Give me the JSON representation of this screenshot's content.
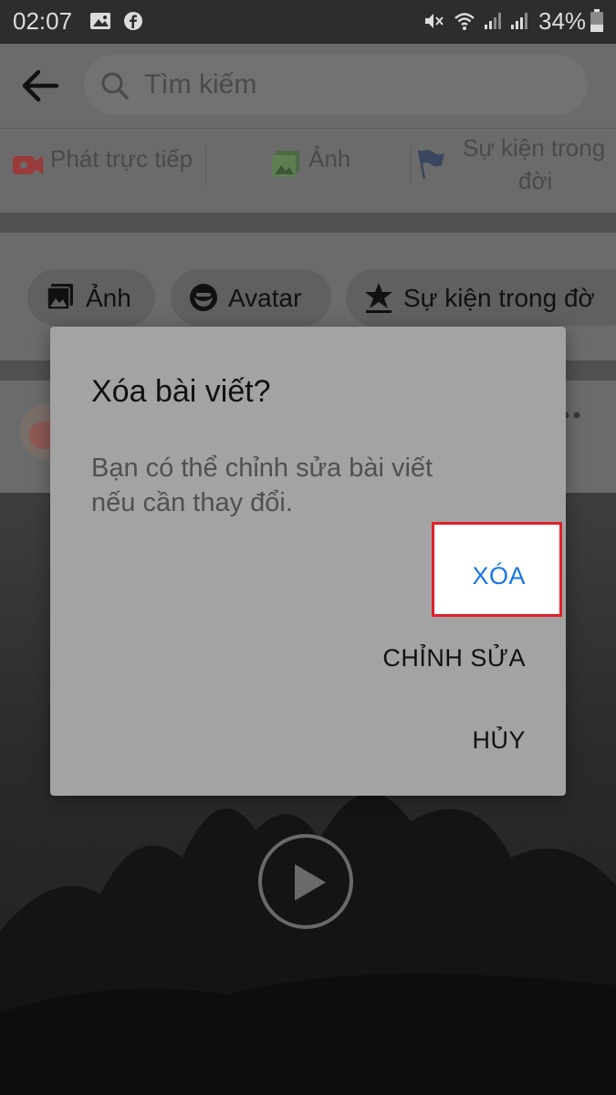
{
  "status_bar": {
    "time": "02:07",
    "battery": "34%",
    "icons": [
      "gallery-icon",
      "facebook-icon",
      "mute-icon",
      "wifi-icon",
      "signal-icon",
      "signal-icon",
      "battery-icon"
    ]
  },
  "app_bar": {
    "back_icon": "back-arrow-icon",
    "search_placeholder": "Tìm kiếm"
  },
  "composer": {
    "live_label": "Phát trực tiếp",
    "photo_label": "Ảnh",
    "life_event_label_line1": "Sự kiện trong",
    "life_event_label_line2": "đời"
  },
  "chips": {
    "photo": "Ảnh",
    "avatar": "Avatar",
    "life_event": "Sự kiện trong đờ"
  },
  "dialog": {
    "title": "Xóa bài viết?",
    "message_line1": "Bạn có thể chỉnh sửa bài viết",
    "message_line2": "nếu cần thay đổi.",
    "delete_label": "XÓA",
    "edit_label": "CHỈNH SỬA",
    "cancel_label": "HỦY",
    "highlight_color": "#e0202a",
    "accent_color": "#1a73e8"
  }
}
